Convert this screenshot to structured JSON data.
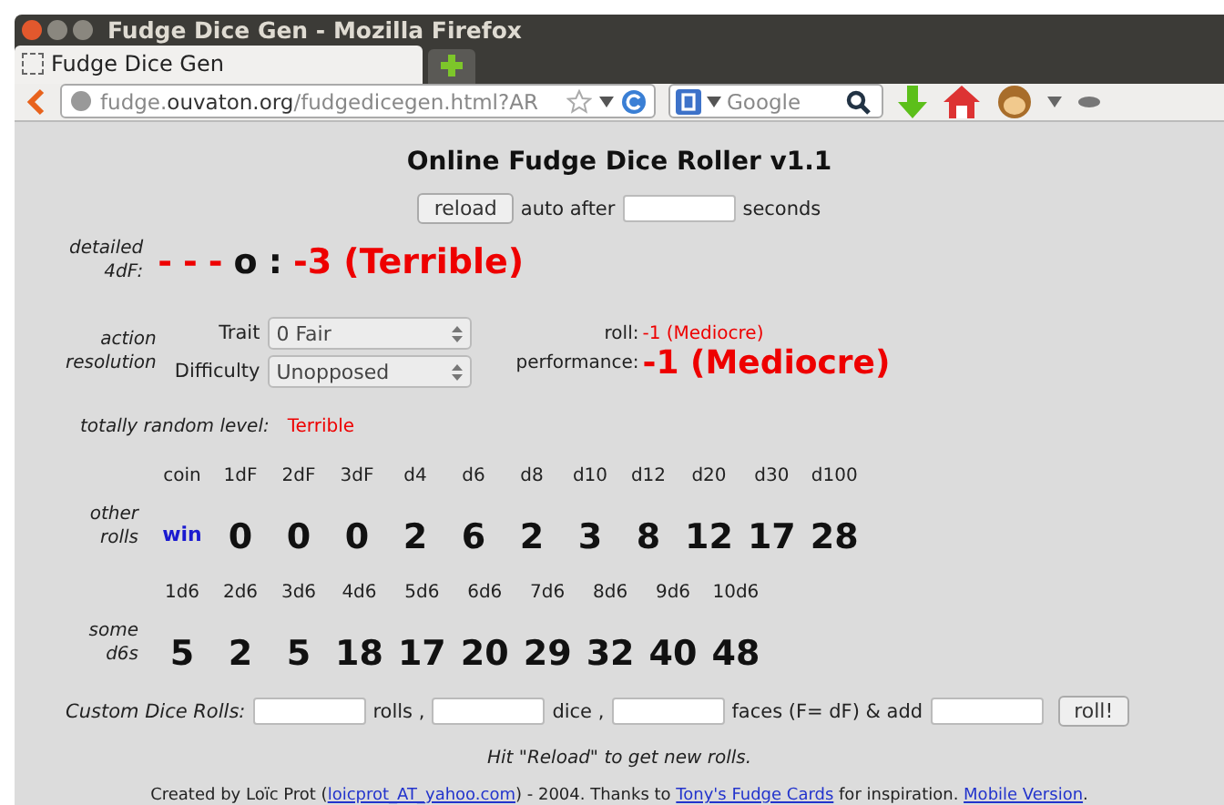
{
  "window": {
    "title": "Fudge Dice Gen - Mozilla Firefox"
  },
  "tabs": [
    {
      "label": "Fudge Dice Gen",
      "selected": true
    }
  ],
  "address": {
    "host_pre": "fudge.",
    "host": "ouvaton.org",
    "path": "/fudgedicegen.html?AR"
  },
  "search": {
    "placeholder": "Google"
  },
  "page": {
    "heading": "Online Fudge Dice Roller v1.1",
    "reload": {
      "button": "reload",
      "auto_after": "auto after",
      "seconds": "seconds"
    },
    "detailed": {
      "label": "detailed\n4dF:",
      "dice": [
        "-",
        "-",
        "-",
        "o"
      ],
      "sep": ":",
      "result": "-3 (Terrible)"
    },
    "action": {
      "label": "action\nresolution",
      "trait_label": "Trait",
      "trait": "0 Fair",
      "difficulty_label": "Difficulty",
      "difficulty": "Unopposed",
      "roll_label": "roll:",
      "roll": "-1 (Mediocre)",
      "performance_label": "performance:",
      "performance": "-1 (Mediocre)"
    },
    "random": {
      "label": "totally random level:",
      "value": "Terrible"
    },
    "other": {
      "label": "other\nrolls",
      "columns": [
        {
          "head": "coin",
          "value": "win",
          "kind": "word"
        },
        {
          "head": "1dF",
          "value": "0",
          "kind": "number"
        },
        {
          "head": "2dF",
          "value": "0",
          "kind": "number"
        },
        {
          "head": "3dF",
          "value": "0",
          "kind": "number"
        },
        {
          "head": "d4",
          "value": "2",
          "kind": "number"
        },
        {
          "head": "d6",
          "value": "6",
          "kind": "number"
        },
        {
          "head": "d8",
          "value": "2",
          "kind": "number"
        },
        {
          "head": "d10",
          "value": "3",
          "kind": "number"
        },
        {
          "head": "d12",
          "value": "8",
          "kind": "number"
        },
        {
          "head": "d20",
          "value": "12",
          "kind": "number"
        },
        {
          "head": "d30",
          "value": "17",
          "kind": "number"
        },
        {
          "head": "d100",
          "value": "28",
          "kind": "number"
        }
      ]
    },
    "d6s": {
      "label": "some\nd6s",
      "columns": [
        {
          "head": "1d6",
          "value": "5"
        },
        {
          "head": "2d6",
          "value": "2"
        },
        {
          "head": "3d6",
          "value": "5"
        },
        {
          "head": "4d6",
          "value": "18"
        },
        {
          "head": "5d6",
          "value": "17"
        },
        {
          "head": "6d6",
          "value": "20"
        },
        {
          "head": "7d6",
          "value": "29"
        },
        {
          "head": "8d6",
          "value": "32"
        },
        {
          "head": "9d6",
          "value": "40"
        },
        {
          "head": "10d6",
          "value": "48"
        }
      ]
    },
    "custom": {
      "label": "Custom Dice Rolls:",
      "rolls": "rolls ,",
      "dice": "dice ,",
      "faces": "faces (F= dF) & add",
      "button": "roll!"
    },
    "hint": "Hit \"Reload\" to get new rolls.",
    "footer": [
      {
        "kind": "text",
        "text": "Created by Loïc Prot ("
      },
      {
        "kind": "link",
        "text": "loicprot_AT_yahoo.com"
      },
      {
        "kind": "text",
        "text": ") - 2004. Thanks to "
      },
      {
        "kind": "link",
        "text": "Tony's Fudge Cards"
      },
      {
        "kind": "text",
        "text": " for inspiration. "
      },
      {
        "kind": "link",
        "text": "Mobile Version"
      },
      {
        "kind": "text",
        "text": "."
      }
    ]
  }
}
